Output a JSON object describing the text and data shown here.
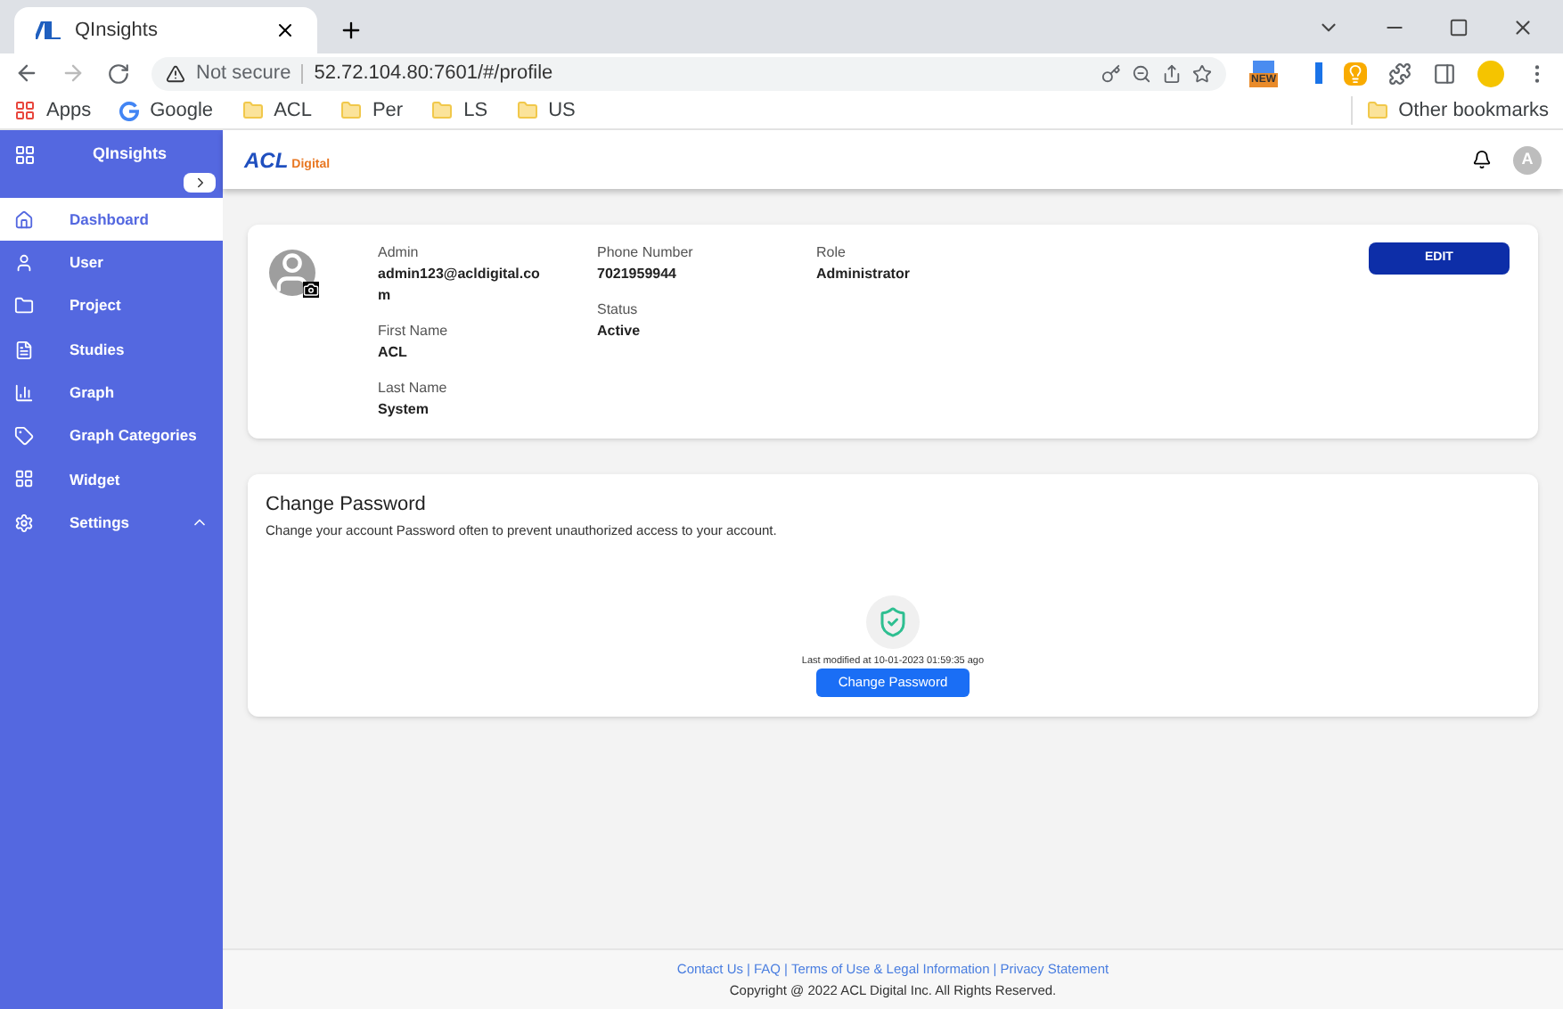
{
  "browser": {
    "tab_title": "QInsights",
    "security": "Not secure",
    "url": "52.72.104.80:7601/#/profile",
    "extension_badge": "NEW",
    "bookmarks": [
      {
        "label": "Apps",
        "kind": "apps"
      },
      {
        "label": "Google",
        "kind": "google"
      },
      {
        "label": "ACL",
        "kind": "folder"
      },
      {
        "label": "Per",
        "kind": "folder"
      },
      {
        "label": "LS",
        "kind": "folder"
      },
      {
        "label": "US",
        "kind": "folder"
      }
    ],
    "other_bookmarks": "Other bookmarks"
  },
  "sidebar": {
    "title": "QInsights",
    "items": [
      {
        "label": "Dashboard",
        "kind": "home",
        "selected": true
      },
      {
        "label": "User",
        "kind": "user",
        "selected": false
      },
      {
        "label": "Project",
        "kind": "folder",
        "selected": false
      },
      {
        "label": "Studies",
        "kind": "file",
        "selected": false
      },
      {
        "label": "Graph",
        "kind": "chart",
        "selected": false
      },
      {
        "label": "Graph Categories",
        "kind": "tag",
        "selected": false
      },
      {
        "label": "Widget",
        "kind": "widget",
        "selected": false
      },
      {
        "label": "Settings",
        "kind": "settings",
        "selected": false,
        "expanded": true
      }
    ]
  },
  "header": {
    "logo_main": "ACL",
    "logo_sub": "Digital",
    "avatar": "A"
  },
  "profile": {
    "fields": [
      {
        "label": "Admin",
        "value": "admin123@acldigital.com"
      },
      {
        "label": "First Name",
        "value": "ACL"
      },
      {
        "label": "Last Name",
        "value": "System"
      },
      {
        "label": "Phone Number",
        "value": "7021959944"
      },
      {
        "label": "Status",
        "value": "Active"
      },
      {
        "label": "Role",
        "value": "Administrator"
      }
    ],
    "edit_button": "EDIT"
  },
  "change_password": {
    "title": "Change Password",
    "description": "Change your account Password often to prevent unauthorized access to your account.",
    "last_modified": "Last modified at 10-01-2023 01:59:35 ago",
    "button": "Change Password"
  },
  "footer": {
    "links": [
      "Contact Us",
      "FAQ",
      "Terms of Use & Legal Information",
      "Privacy Statement"
    ],
    "separator": "|",
    "copyright": "Copyright @ 2022 ACL Digital Inc. All Rights Reserved."
  }
}
